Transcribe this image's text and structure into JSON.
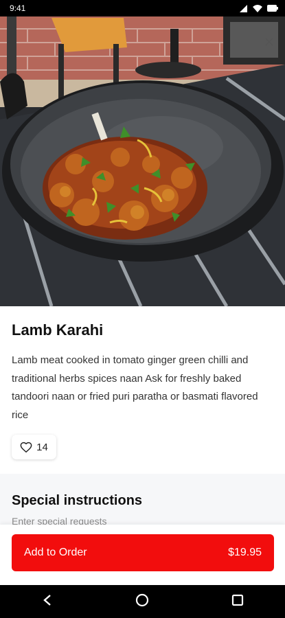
{
  "status_bar": {
    "time": "9:41",
    "icons": [
      "signal-icon",
      "wifi-icon",
      "battery-icon"
    ]
  },
  "hero": {
    "image_subject": "lamb karahi in a black wok",
    "close_icon": "close-icon"
  },
  "item": {
    "title": "Lamb Karahi",
    "description": "Lamb meat cooked in tomato ginger green chilli and traditional herbs spices naan Ask for freshly baked tandoori naan or fried puri paratha or basmati flavored rice",
    "likes": "14",
    "like_icon": "heart-icon"
  },
  "special_instructions": {
    "title": "Special instructions",
    "placeholder": "Enter special requests"
  },
  "order": {
    "label": "Add to Order",
    "price": "$19.95"
  },
  "nav_bar": {
    "icons": [
      "back-icon",
      "home-icon",
      "recents-icon"
    ]
  },
  "colors": {
    "accent": "#f20d0d",
    "status_bar": "#000000",
    "section_bg": "#f6f7f9"
  }
}
